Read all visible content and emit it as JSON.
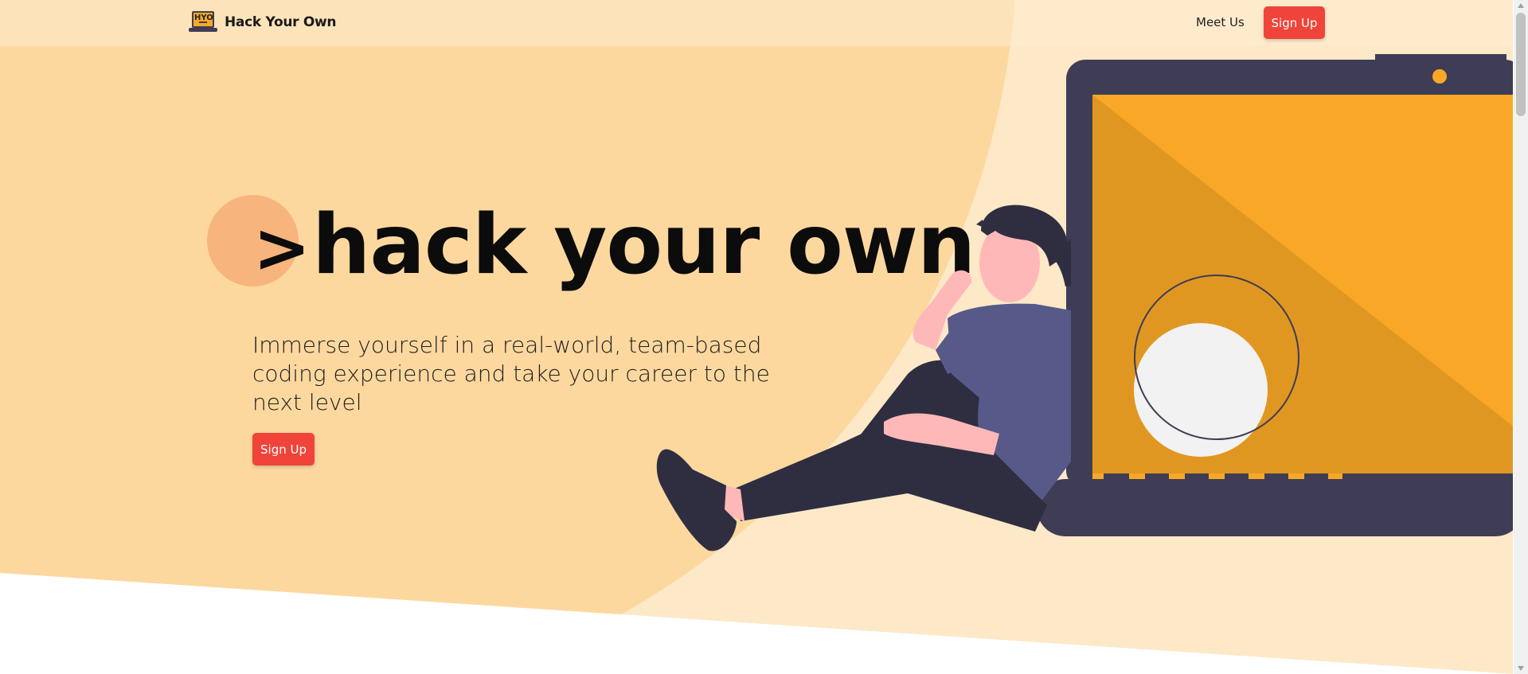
{
  "nav": {
    "logo_text": "HYO",
    "brand_name": "Hack Your Own",
    "meet_us_label": "Meet Us",
    "signup_label": "Sign Up"
  },
  "hero": {
    "prompt_symbol": ">",
    "title": "hack your own.",
    "subtitle": "Immerse yourself in a real-world, team-based coding experience and take your career to the next level",
    "signup_label": "Sign Up"
  },
  "colors": {
    "accent": "#f0443a",
    "hero_background": "#fcd89f",
    "hero_background_light": "#fde8c8",
    "dot": "#f7b47c",
    "screen_orange": "#f8a826",
    "laptop_dark": "#3f3d56"
  }
}
